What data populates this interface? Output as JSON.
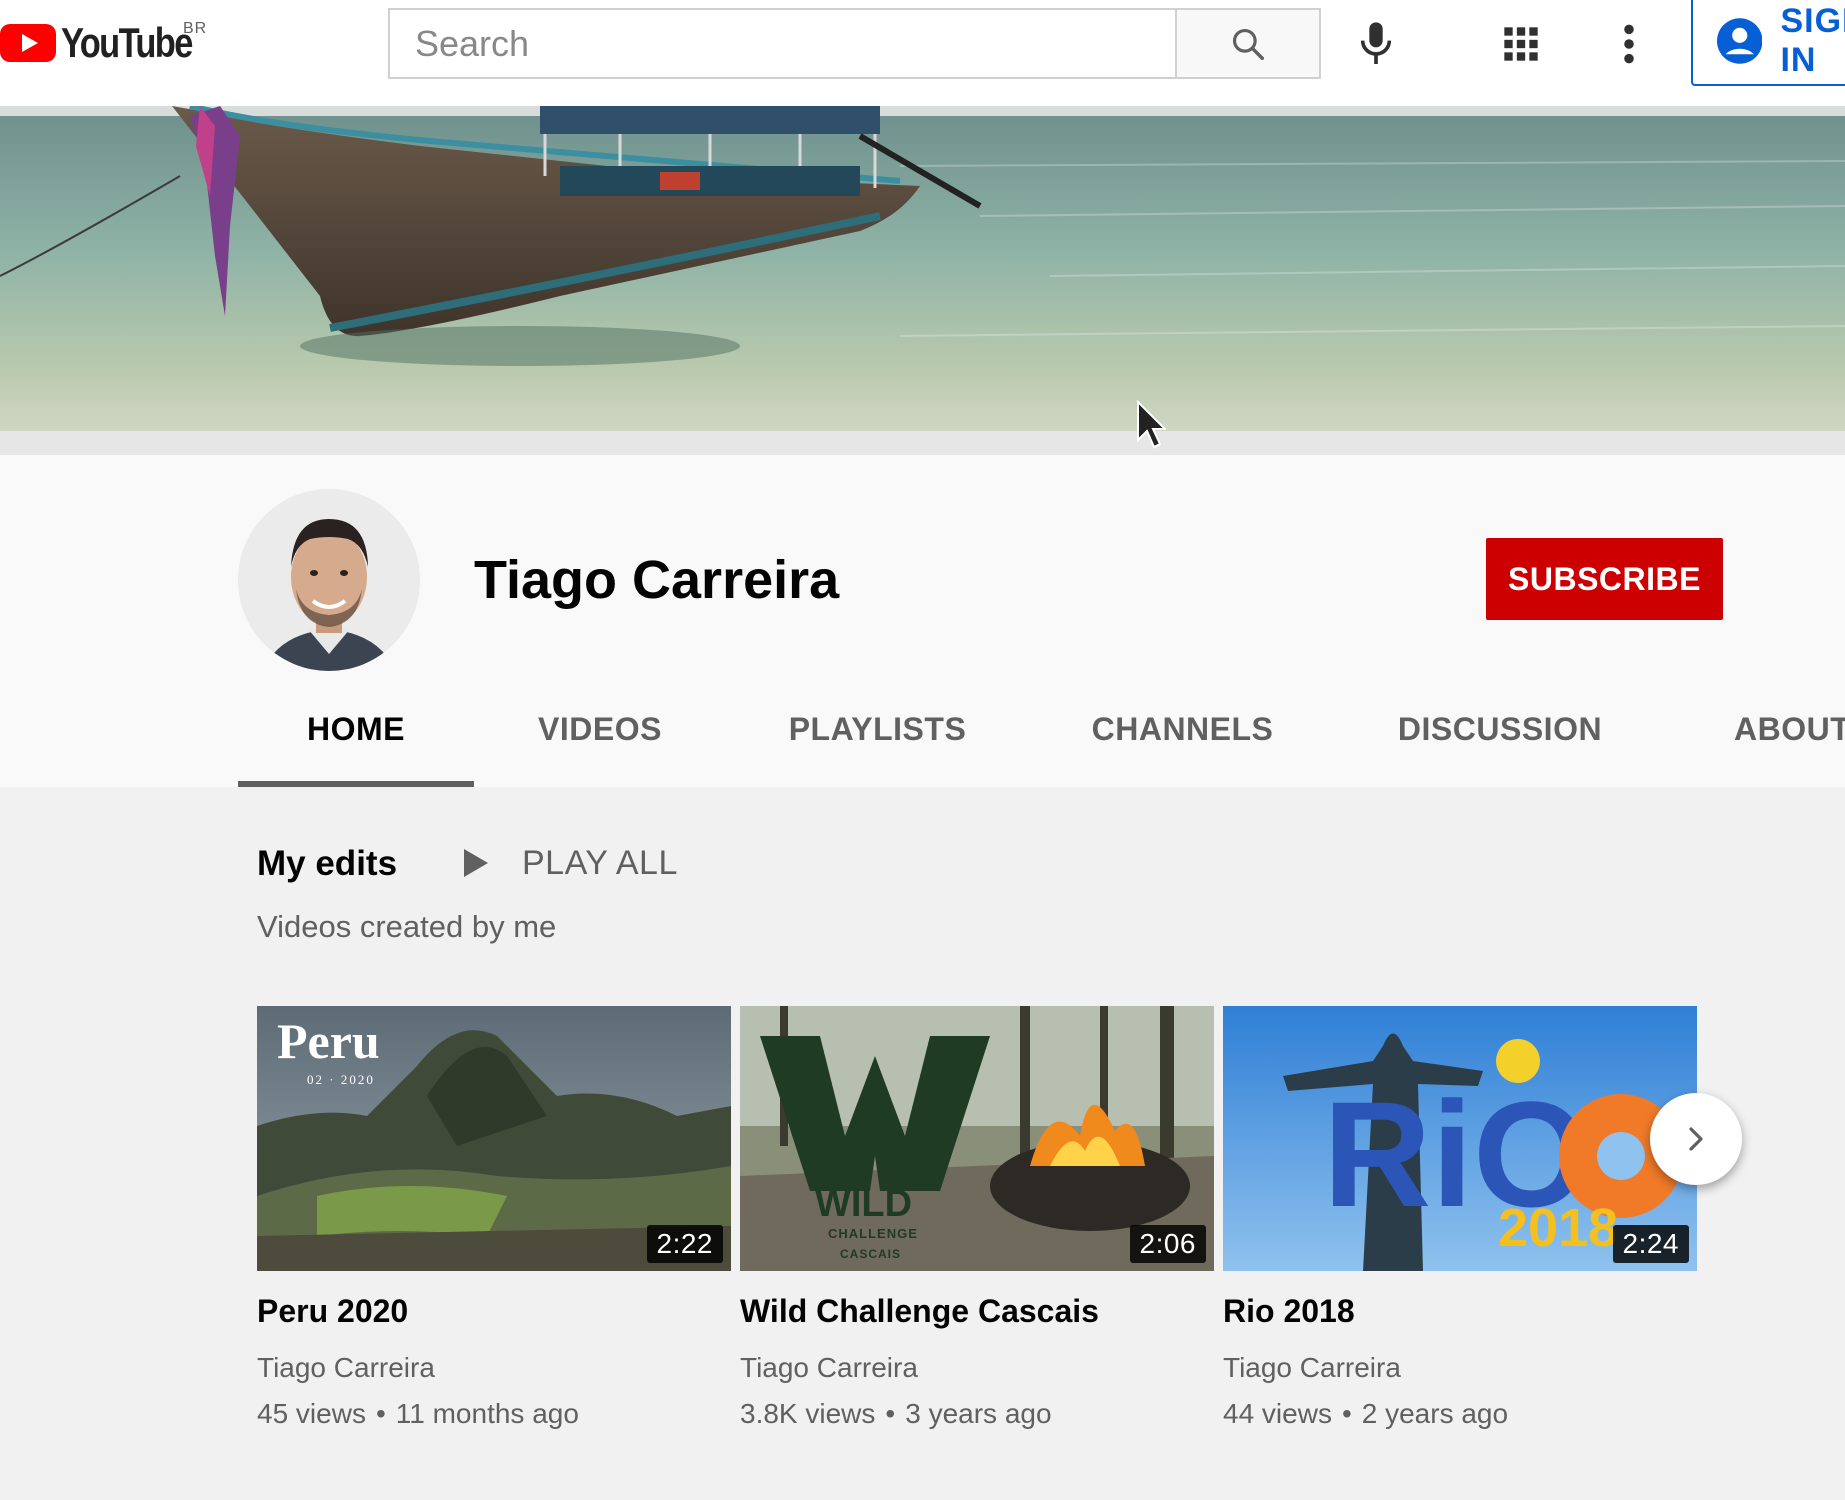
{
  "masthead": {
    "logo_text": "YouTube",
    "country_code": "BR",
    "search_placeholder": "Search",
    "signin_label": "SIGN IN",
    "icons": [
      "youtube-play-icon",
      "search-icon",
      "microphone-icon",
      "apps-grid-icon",
      "more-vert-icon",
      "account-circle-icon"
    ]
  },
  "channel": {
    "name": "Tiago Carreira",
    "subscribe_label": "SUBSCRIBE"
  },
  "tabs": [
    {
      "label": "HOME",
      "active": true
    },
    {
      "label": "VIDEOS",
      "active": false
    },
    {
      "label": "PLAYLISTS",
      "active": false
    },
    {
      "label": "CHANNELS",
      "active": false
    },
    {
      "label": "DISCUSSION",
      "active": false
    },
    {
      "label": "ABOUT",
      "active": false
    }
  ],
  "shelf": {
    "title": "My edits",
    "play_all_label": "PLAY ALL",
    "subtitle": "Videos created by me"
  },
  "videos": [
    {
      "title": "Peru 2020",
      "channel": "Tiago Carreira",
      "views": "45 views",
      "age": "11 months ago",
      "duration": "2:22",
      "thumb_title": "Peru",
      "thumb_subtitle": "02 · 2020"
    },
    {
      "title": "Wild Challenge Cascais",
      "channel": "Tiago Carreira",
      "views": "3.8K views",
      "age": "3 years ago",
      "duration": "2:06",
      "thumb_title": "WILD",
      "thumb_subtitle": "CHALLENGE",
      "thumb_subtitle2": "CASCAIS"
    },
    {
      "title": "Rio 2018",
      "channel": "Tiago Carreira",
      "views": "44 views",
      "age": "2 years ago",
      "duration": "2:24",
      "thumb_title": "RiO",
      "thumb_subtitle": "2018"
    }
  ],
  "separator": "•",
  "colors": {
    "brand_red": "#ff0000",
    "subscribe_red": "#cc0000",
    "signin_blue": "#065fd4",
    "page_bg": "#f1f1f1",
    "secondary_text": "#606060"
  }
}
